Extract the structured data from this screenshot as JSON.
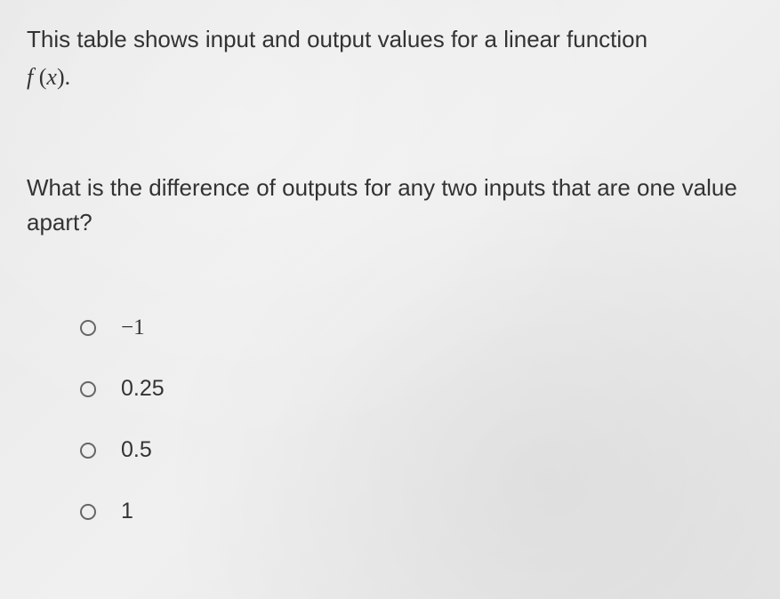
{
  "intro": "This table shows input and output values for a linear function",
  "function_label_f": "f",
  "function_label_open": " (",
  "function_label_x": "x",
  "function_label_close": ").",
  "question": "What is the difference of outputs for any two inputs that are one value apart?",
  "options": [
    {
      "label": "−1"
    },
    {
      "label": "0.25"
    },
    {
      "label": "0.5"
    },
    {
      "label": "1"
    }
  ]
}
